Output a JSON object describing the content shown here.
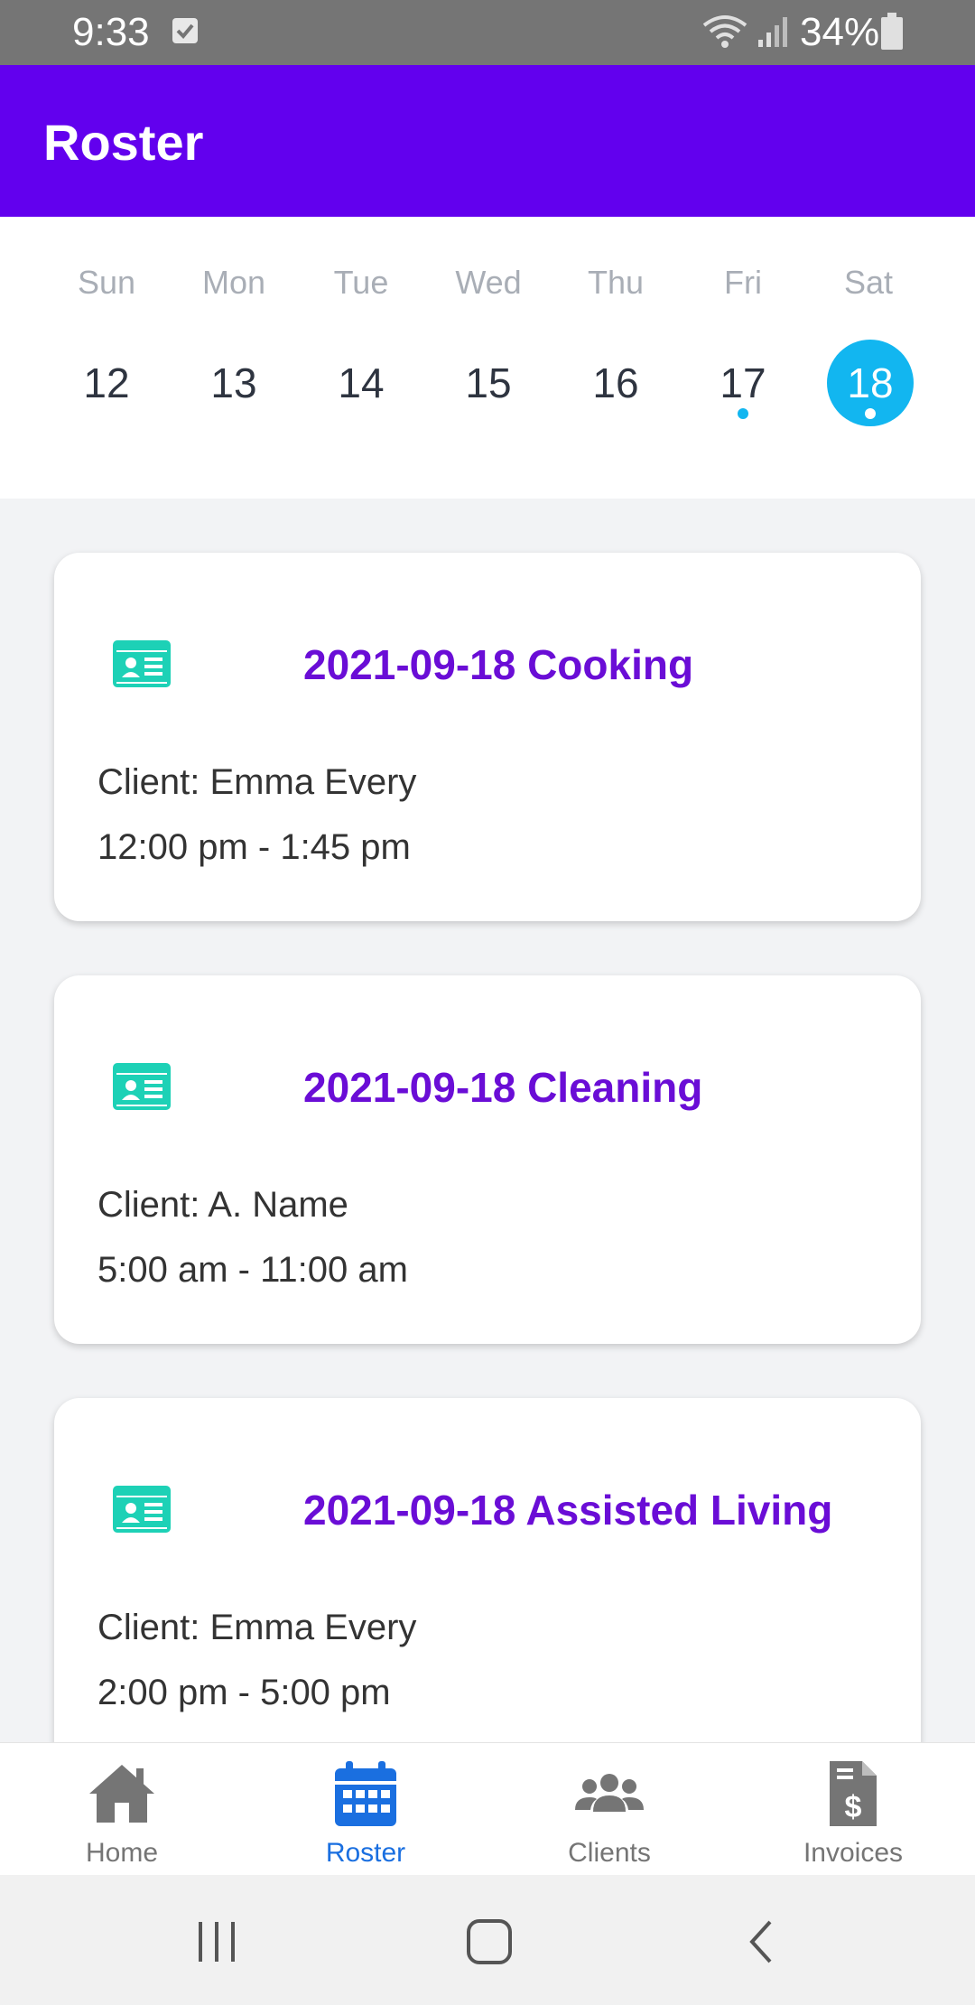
{
  "status_bar": {
    "time": "9:33",
    "battery": "34%",
    "icons": [
      "checkbox-notification-icon",
      "wifi-icon",
      "signal-icon",
      "battery-icon"
    ]
  },
  "app_bar": {
    "title": "Roster"
  },
  "week": {
    "days": [
      {
        "name": "Sun",
        "date": "12"
      },
      {
        "name": "Mon",
        "date": "13"
      },
      {
        "name": "Tue",
        "date": "14"
      },
      {
        "name": "Wed",
        "date": "15"
      },
      {
        "name": "Thu",
        "date": "16"
      },
      {
        "name": "Fri",
        "date": "17"
      },
      {
        "name": "Sat",
        "date": "18"
      }
    ],
    "selected_date": "18",
    "dates_with_events": [
      "17",
      "18"
    ],
    "accent_color": "#12B6F0"
  },
  "shifts": [
    {
      "title": "2021-09-18 Cooking",
      "client": "Client: Emma Every",
      "time": "12:00 pm - 1:45 pm",
      "icon": "id-card-icon"
    },
    {
      "title": "2021-09-18 Cleaning",
      "client": "Client: A. Name",
      "time": "5:00 am - 11:00 am",
      "icon": "id-card-icon"
    },
    {
      "title": "2021-09-18 Assisted Living",
      "client": "Client: Emma Every",
      "time": "2:00 pm - 5:00 pm",
      "icon": "id-card-icon"
    }
  ],
  "bottom_nav": {
    "items": [
      {
        "label": "Home",
        "icon": "home-icon"
      },
      {
        "label": "Roster",
        "icon": "calendar-icon",
        "active": true
      },
      {
        "label": "Clients",
        "icon": "users-icon"
      },
      {
        "label": "Invoices",
        "icon": "invoice-dollar-icon"
      }
    ],
    "active_color": "#1A6FE0"
  },
  "colors": {
    "primary": "#6200EE",
    "card_title": "#6A0DD6",
    "icon_teal": "#1DD1B6"
  }
}
